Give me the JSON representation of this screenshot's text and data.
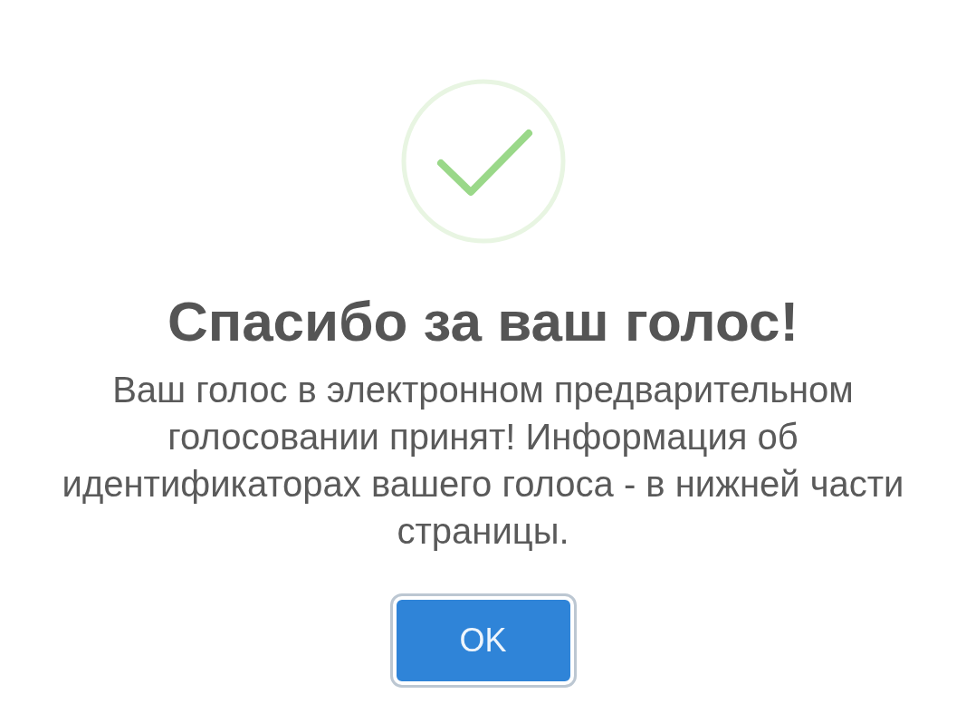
{
  "dialog": {
    "title": "Спасибо за ваш голос!",
    "message": "Ваш голос в электронном предварительном голосовании принят! Информация об идентификаторах вашего голоса - в нижней части страницы.",
    "buttons": [
      {
        "label": "OK"
      }
    ]
  }
}
